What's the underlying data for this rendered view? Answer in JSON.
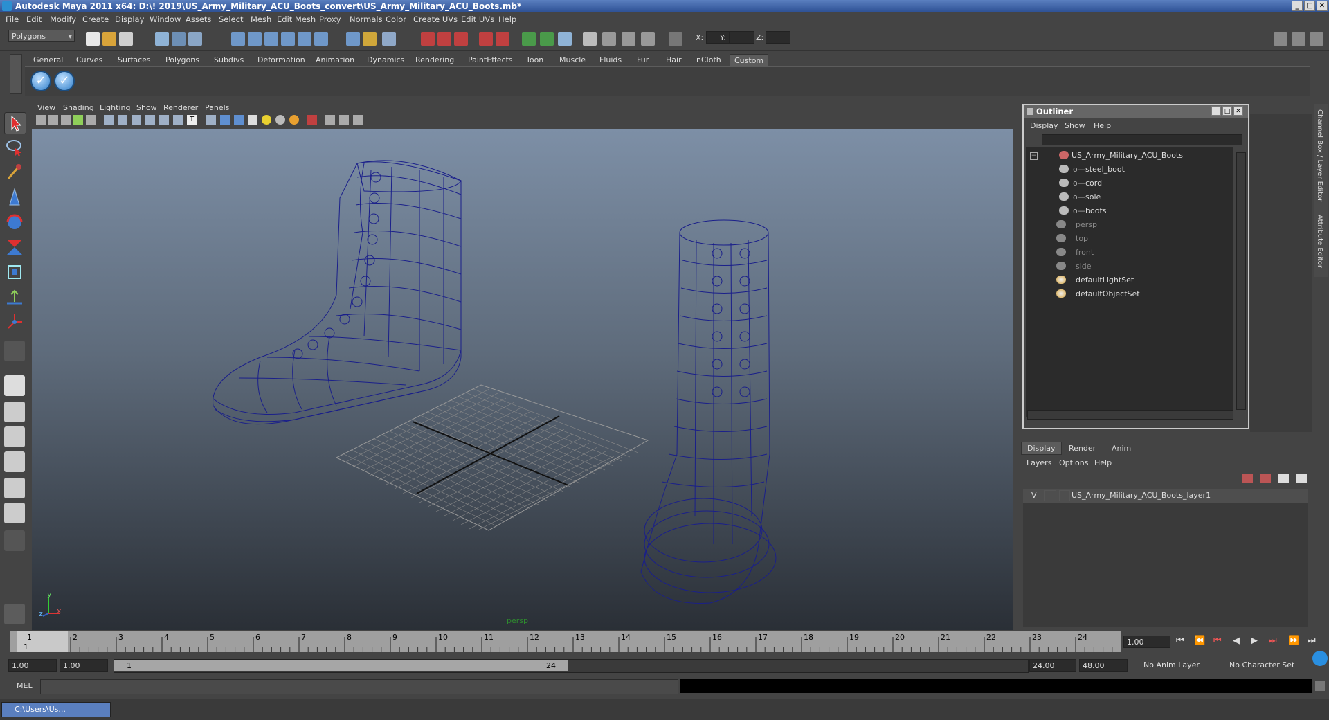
{
  "window": {
    "title": "Autodesk Maya 2011 x64: D:\\! 2019\\US_Army_Military_ACU_Boots_convert\\US_Army_Military_ACU_Boots.mb*"
  },
  "menubar": [
    "File",
    "Edit",
    "Modify",
    "Create",
    "Display",
    "Window",
    "Assets",
    "Select",
    "Mesh",
    "Edit Mesh",
    "Proxy",
    "Normals",
    "Color",
    "Create UVs",
    "Edit UVs",
    "Help"
  ],
  "statusline": {
    "mode": "Polygons",
    "x_label": "X:",
    "y_label": "Y:",
    "z_label": "Z:"
  },
  "shelf": {
    "tabs": [
      "General",
      "Curves",
      "Surfaces",
      "Polygons",
      "Subdivs",
      "Deformation",
      "Animation",
      "Dynamics",
      "Rendering",
      "PaintEffects",
      "Toon",
      "Muscle",
      "Fluids",
      "Fur",
      "Hair",
      "nCloth",
      "Custom"
    ],
    "active": "Custom"
  },
  "viewport": {
    "menu": [
      "View",
      "Shading",
      "Lighting",
      "Show",
      "Renderer",
      "Panels"
    ],
    "camera_label": "persp",
    "axis_y": "y",
    "axis_x": "x",
    "axis_z": "z"
  },
  "outliner": {
    "title": "Outliner",
    "menu": [
      "Display",
      "Show",
      "Help"
    ],
    "root": "US_Army_Military_ACU_Boots",
    "children": [
      "steel_boot",
      "cord",
      "sole",
      "boots"
    ],
    "cameras": [
      "persp",
      "top",
      "front",
      "side"
    ],
    "sets": [
      "defaultLightSet",
      "defaultObjectSet"
    ]
  },
  "side_tabs": {
    "channel_box": "Channel Box / Layer Editor",
    "attribute_editor": "Attribute Editor"
  },
  "layer_editor": {
    "tabs": [
      "Display",
      "Render",
      "Anim"
    ],
    "menu": [
      "Layers",
      "Options",
      "Help"
    ],
    "layer": {
      "visible": "V",
      "name": "US_Army_Military_ACU_Boots_layer1"
    }
  },
  "timeline": {
    "ticks": [
      "1",
      "2",
      "3",
      "4",
      "5",
      "6",
      "7",
      "8",
      "9",
      "10",
      "11",
      "12",
      "13",
      "14",
      "15",
      "16",
      "17",
      "18",
      "19",
      "20",
      "21",
      "22",
      "23",
      "24"
    ],
    "current_frame": "1",
    "current_time": "1.00",
    "start": "1.00",
    "playback_start": "1.00",
    "range_start": "1",
    "range_end": "24",
    "playback_end": "24.00",
    "end": "48.00",
    "anim_layer": "No Anim Layer",
    "char_set": "No Character Set"
  },
  "cmdline": {
    "label": "MEL"
  },
  "taskbar": {
    "item": "C:\\Users\\Us..."
  }
}
